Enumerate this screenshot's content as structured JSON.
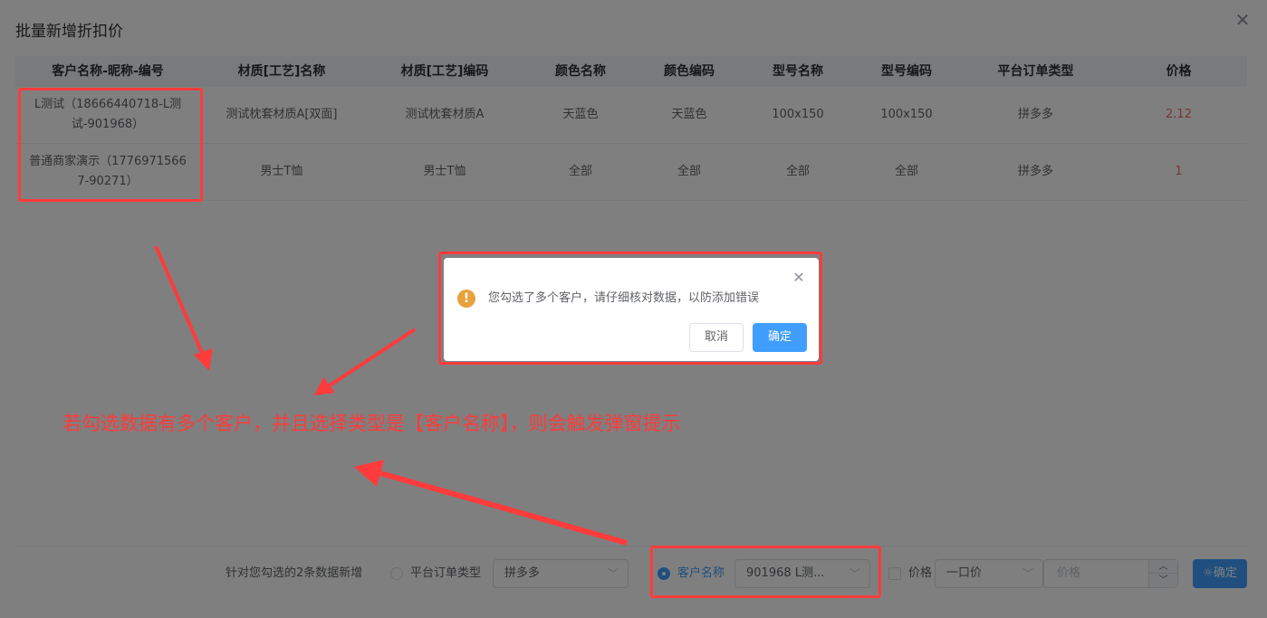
{
  "dialog": {
    "title": "批量新增折扣价",
    "close_icon": "close-icon"
  },
  "table": {
    "headers": [
      "客户名称-昵称-编号",
      "材质[工艺]名称",
      "材质[工艺]编码",
      "颜色名称",
      "颜色编码",
      "型号名称",
      "型号编码",
      "平台订单类型",
      "价格"
    ],
    "rows": [
      {
        "customer_line1": "L测试（18666440718-L测",
        "customer_line2": "试-901968）",
        "material_name": "测试枕套材质A[双面]",
        "material_code": "测试枕套材质A",
        "color_name": "天蓝色",
        "color_code": "天蓝色",
        "model_name": "100x150",
        "model_code": "100x150",
        "platform": "拼多多",
        "price": "2.12"
      },
      {
        "customer_line1": "普通商家演示（1776971566",
        "customer_line2": "7-90271）",
        "material_name": "男士T恤",
        "material_code": "男士T恤",
        "color_name": "全部",
        "color_code": "全部",
        "model_name": "全部",
        "model_code": "全部",
        "platform": "拼多多",
        "price": "1"
      }
    ]
  },
  "footer": {
    "prefix": "针对您勾选的2条数据新增",
    "platform_radio_label": "平台订单类型",
    "platform_select_value": "拼多多",
    "customer_radio_label": "客户名称",
    "customer_select_value": "901968  L测...",
    "price_checkbox_label": "价格",
    "price_type_value": "一口价",
    "price_placeholder": "价格",
    "confirm_label": "确定"
  },
  "message_box": {
    "text": "您勾选了多个客户，请仔细核对数据，以防添加错误",
    "cancel_label": "取消",
    "ok_label": "确定",
    "warning_icon": "warning-icon"
  },
  "annotation": {
    "text": "若勾选数据有多个客户，并且选择类型是【客户名称】，则会触发弹窗提示",
    "color": "#ff3b3b"
  },
  "colors": {
    "primary": "#409eff",
    "price": "#f56c6c",
    "warning": "#e6a23c"
  }
}
